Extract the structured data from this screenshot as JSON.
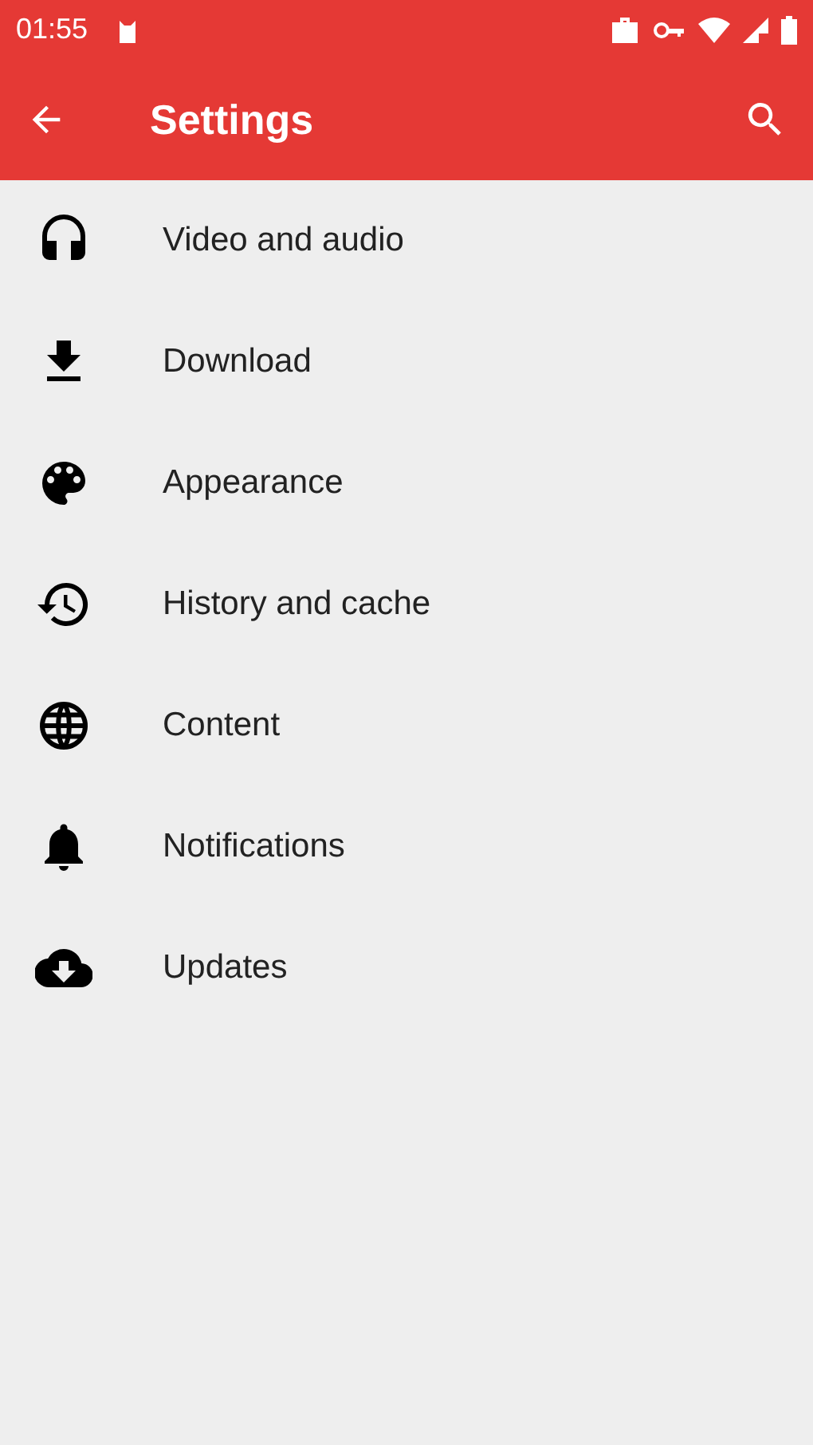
{
  "status_bar": {
    "time": "01:55"
  },
  "toolbar": {
    "title": "Settings"
  },
  "items": [
    {
      "label": "Video and audio"
    },
    {
      "label": "Download"
    },
    {
      "label": "Appearance"
    },
    {
      "label": "History and cache"
    },
    {
      "label": "Content"
    },
    {
      "label": "Notifications"
    },
    {
      "label": "Updates"
    }
  ]
}
